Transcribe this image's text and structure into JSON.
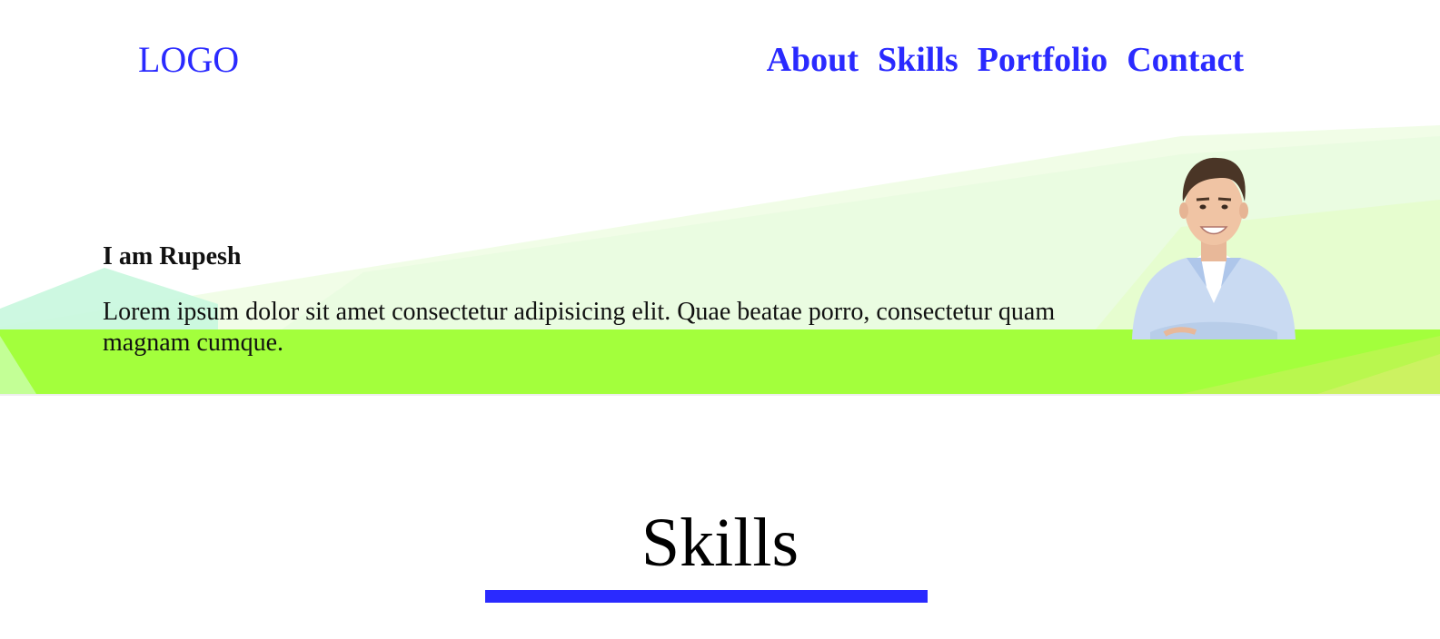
{
  "header": {
    "logo": "LOGO",
    "nav": [
      {
        "label": "About"
      },
      {
        "label": "Skills"
      },
      {
        "label": "Portfolio"
      },
      {
        "label": "Contact"
      }
    ]
  },
  "hero": {
    "title": "I am Rupesh",
    "description": "Lorem ipsum dolor sit amet consectetur adipisicing elit. Quae beatae porro, consectetur quam magnam cumque."
  },
  "skills": {
    "heading": "Skills"
  },
  "colors": {
    "accent": "#2a2aff",
    "hero_band": "#a3ff3c",
    "text": "#111111"
  }
}
